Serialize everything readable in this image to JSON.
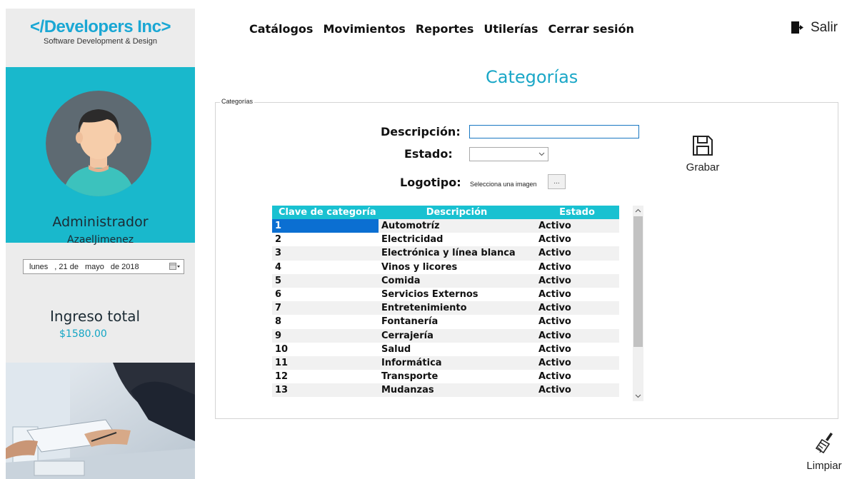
{
  "logo": {
    "title": "</Developers Inc>",
    "subtitle": "Software Development & Design"
  },
  "menu": [
    "Catálogos",
    "Movimientos",
    "Reportes",
    "Utilerías",
    "Cerrar sesión"
  ],
  "exit": {
    "label": "Salir",
    "icon": "exit-door-icon"
  },
  "sidebar": {
    "role": "Administrador",
    "user": "AzaelJimenez",
    "date": {
      "weekday": "lunes",
      "day": ", 21 de",
      "month": "mayo",
      "year": "de 2018"
    },
    "income_label": "Ingreso total",
    "income_value": "$1580.00"
  },
  "page": {
    "title": "Categorías",
    "group_label": "Categorías",
    "fields": {
      "description_label": "Descripción:",
      "description_value": "",
      "state_label": "Estado:",
      "state_value": "",
      "logo_label": "Logotipo:",
      "logo_hint": "Selecciona una imagen",
      "browse_label": "..."
    },
    "save_label": "Grabar",
    "clear_label": "Limpiar"
  },
  "grid": {
    "headers": [
      "Clave de categoría",
      "Descripción",
      "Estado"
    ],
    "rows": [
      [
        "1",
        "Automotríz",
        "Activo"
      ],
      [
        "2",
        "Electricidad",
        "Activo"
      ],
      [
        "3",
        "Electrónica y línea blanca",
        "Activo"
      ],
      [
        "4",
        "Vinos y licores",
        "Activo"
      ],
      [
        "5",
        "Comida",
        "Activo"
      ],
      [
        "6",
        "Servicios Externos",
        "Activo"
      ],
      [
        "7",
        "Entretenimiento",
        "Activo"
      ],
      [
        "8",
        "Fontanería",
        "Activo"
      ],
      [
        "9",
        "Cerrajería",
        "Activo"
      ],
      [
        "10",
        "Salud",
        "Activo"
      ],
      [
        "11",
        "Informática",
        "Activo"
      ],
      [
        "12",
        "Transporte",
        "Activo"
      ],
      [
        "13",
        "Mudanzas",
        "Activo"
      ]
    ],
    "selected_row": 0
  },
  "colors": {
    "accent": "#19b8cc",
    "header": "#19c1d1",
    "selection": "#0b6fd2",
    "income": "#13a5c4",
    "brand": "#1aa7d4"
  }
}
